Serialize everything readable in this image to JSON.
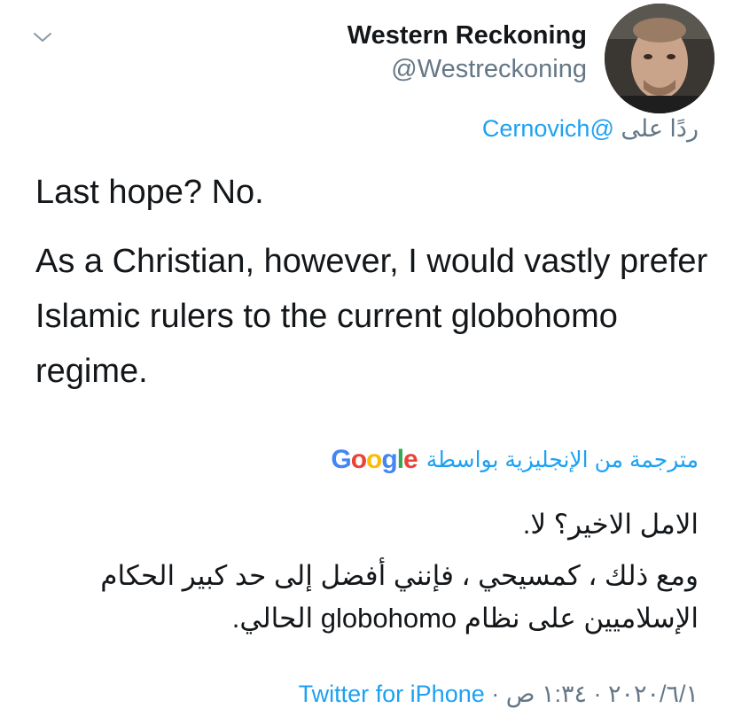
{
  "header": {
    "display_name": "Western Reckoning",
    "handle": "@Westreckoning",
    "avatar_icon": "profile-photo"
  },
  "reply_context": {
    "prefix": "ردًا على",
    "mention": "@Cernovich"
  },
  "tweet": {
    "line1": "Last hope? No.",
    "line2": "As a Christian, however, I would vastly prefer Islamic rulers to the current globohomo regime."
  },
  "translation": {
    "label": "مترجمة من الإنجليزية بواسطة",
    "brand": "Google",
    "para1": "الامل الاخير؟ لا.",
    "para2": "ومع ذلك ، كمسيحي ، فإنني أفضل إلى حد كبير الحكام الإسلاميين على نظام globohomo الحالي."
  },
  "footer": {
    "date": "٢٠٢٠/٦/١",
    "time": "١:٣٤ ص",
    "separator": "·",
    "source": "Twitter for iPhone"
  },
  "colors": {
    "link": "#1da1f2",
    "secondary": "#657786",
    "text": "#14171a",
    "google_blue": "#4285F4",
    "google_red": "#EA4335",
    "google_yellow": "#FBBC05",
    "google_green": "#34A853"
  }
}
